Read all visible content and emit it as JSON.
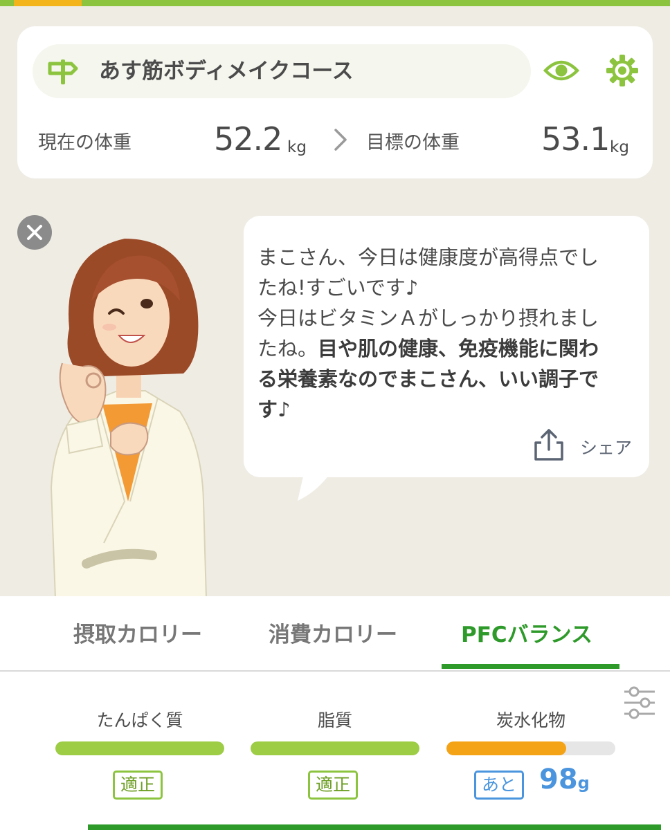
{
  "course": {
    "name": "あす筋ボディメイクコース",
    "current_label": "現在の体重",
    "current_value": "52.2",
    "target_label": "目標の体重",
    "target_value": "53.1",
    "unit": "kg"
  },
  "icons": {
    "course": "signpost-icon",
    "visibility": "eye-icon",
    "settings": "gear-icon",
    "close": "close-icon",
    "share": "share-icon",
    "filter": "sliders-icon"
  },
  "message": {
    "line1": "まこさん、今日は健康度が高得点でし",
    "line2": "たね!すごいです♪",
    "line3": "今日はビタミンＡがしっかり摂れまし",
    "line4a": "たね。",
    "line4b": "目や肌の健康、免疫機能に関わ",
    "line5": "る栄養素なのでまこさん、いい調子で",
    "line6": "す♪",
    "share_label": "シェア"
  },
  "tabs": [
    {
      "label": "摂取カロリー",
      "active": false
    },
    {
      "label": "消費カロリー",
      "active": false
    },
    {
      "label": "PFCバランス",
      "active": true
    }
  ],
  "nutrients": [
    {
      "name": "たんぱく質",
      "fill_ratio": 1.0,
      "color": "#9dcc45",
      "status": "適正"
    },
    {
      "name": "脂質",
      "fill_ratio": 1.0,
      "color": "#9dcc45",
      "status": "適正"
    },
    {
      "name": "炭水化物",
      "fill_ratio": 0.71,
      "color": "#f5a316",
      "status": "あと",
      "remaining_value": "98",
      "remaining_unit": "g"
    }
  ],
  "colors": {
    "accent_green": "#2e9a2a",
    "bar_green": "#9dcc45",
    "bar_orange": "#f5a316",
    "blue": "#4a95de"
  }
}
